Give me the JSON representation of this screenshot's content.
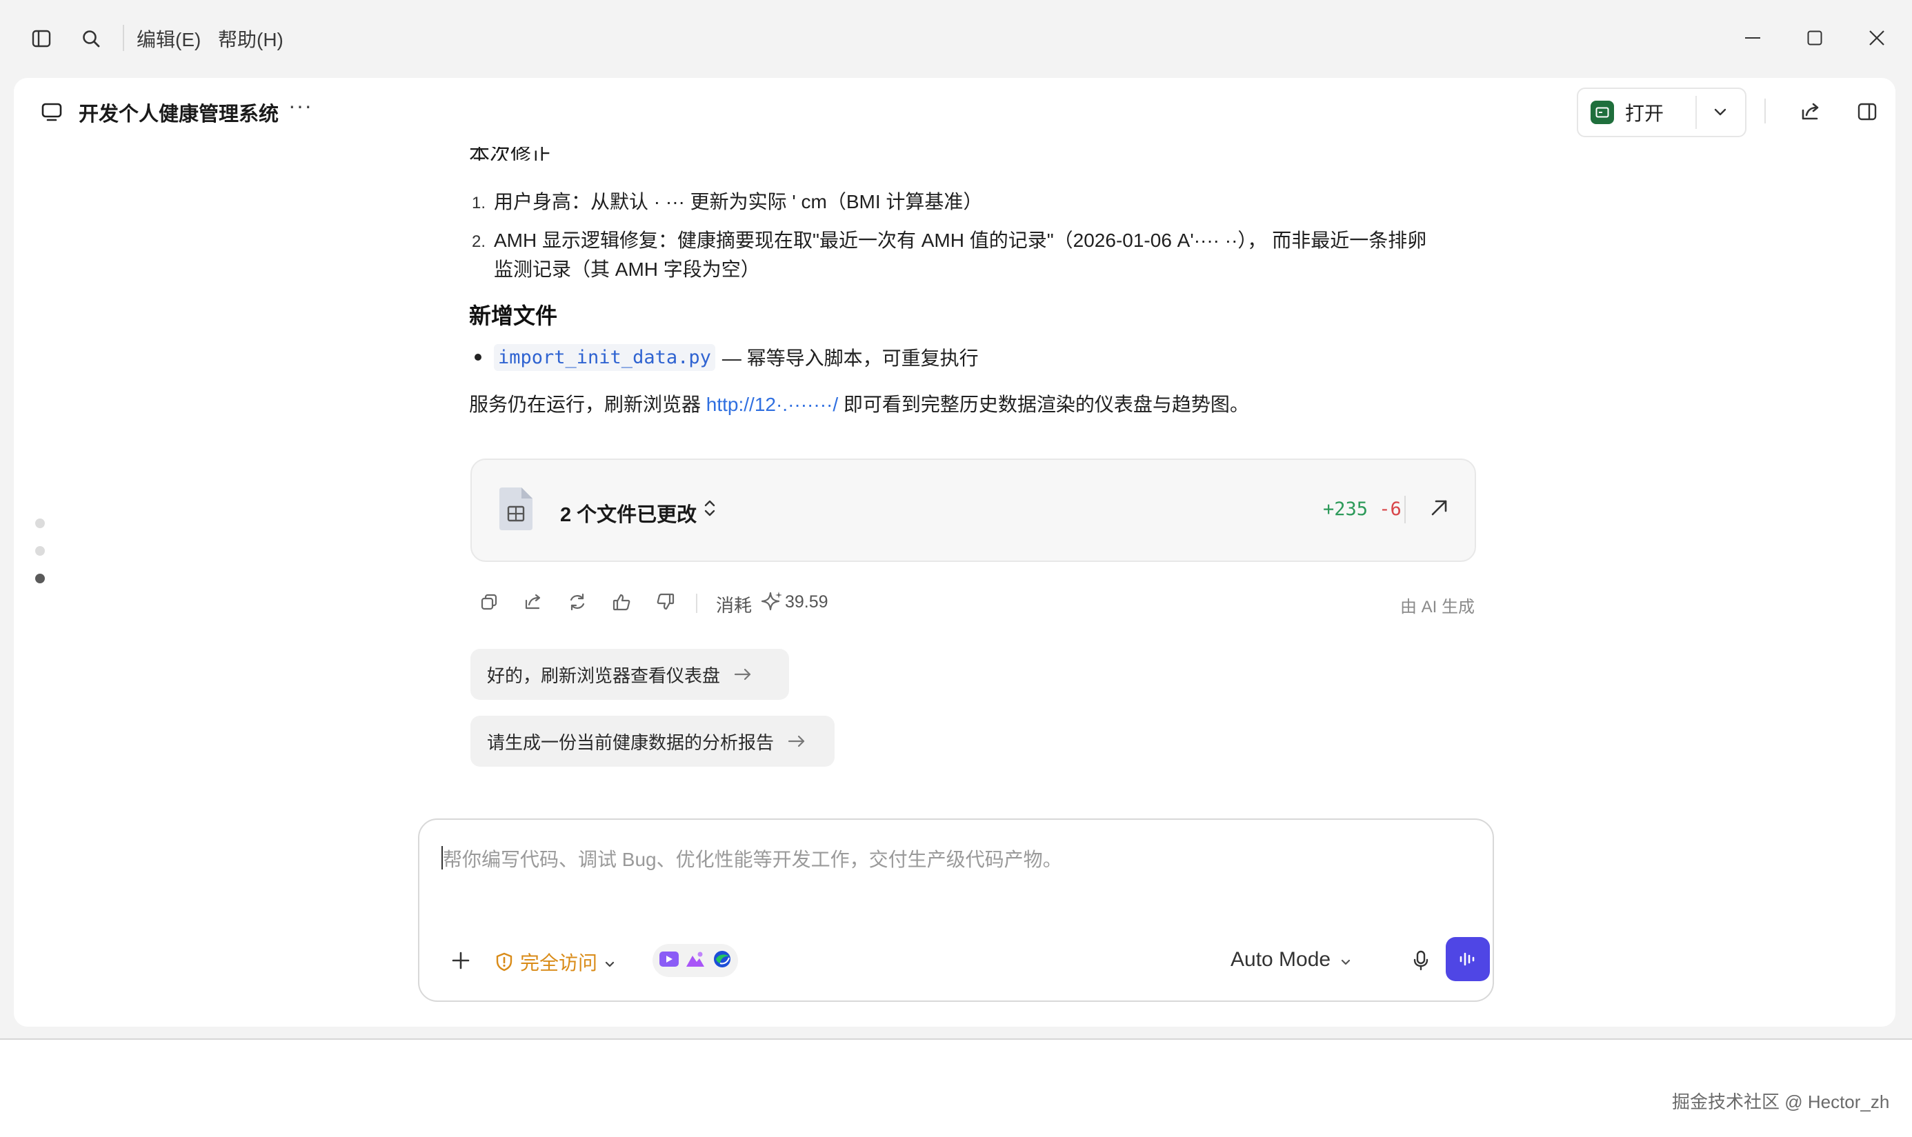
{
  "menu": {
    "edit": "编辑(E)",
    "help": "帮助(H)"
  },
  "header": {
    "title": "开发个人健康管理系统",
    "more": "···",
    "open_label": "打开"
  },
  "message": {
    "top_cut_text": "本次修正",
    "list": [
      {
        "num": "1.",
        "text": "用户身高：从默认 · ··· 更新为实际 ' cm（BMI 计算基准）"
      },
      {
        "num": "2.",
        "text_line1": "AMH 显示逻辑修复：健康摘要现在取\"最近一次有 AMH 值的记录\"（2026-01-06 A'···· ··）， 而非最近一条排卵",
        "text_line2": "监测记录（其 AMH 字段为空）"
      }
    ],
    "section_title": "新增文件",
    "bullet_code": "import_init_data.py",
    "bullet_text": "— 幂等导入脚本，可重复执行",
    "para_before": "服务仍在运行，刷新浏览器 ",
    "para_link": "http://12·.·······/",
    "para_after": " 即可看到完整历史数据渲染的仪表盘与趋势图。"
  },
  "files_card": {
    "label": "2 个文件已更改",
    "added": "+235",
    "removed": "-6"
  },
  "actions": {
    "cost_label": "消耗",
    "cost_value": "39.59",
    "ai_generated": "由 AI 生成"
  },
  "suggestions": [
    {
      "text": "好的，刷新浏览器查看仪表盘"
    },
    {
      "text": "请生成一份当前健康数据的分析报告"
    }
  ],
  "input": {
    "placeholder": "帮你编写代码、调试 Bug、优化性能等开发工作，交付生产级代码产物。",
    "access_label": "完全访问",
    "mode_label": "Auto Mode"
  },
  "watermark": "掘金技术社区 @ Hector_zh",
  "colors": {
    "accent": "#4f46e5",
    "access": "#d98b18",
    "added": "#2d9a5a",
    "removed": "#d8464a",
    "link": "#2f6fe0"
  }
}
